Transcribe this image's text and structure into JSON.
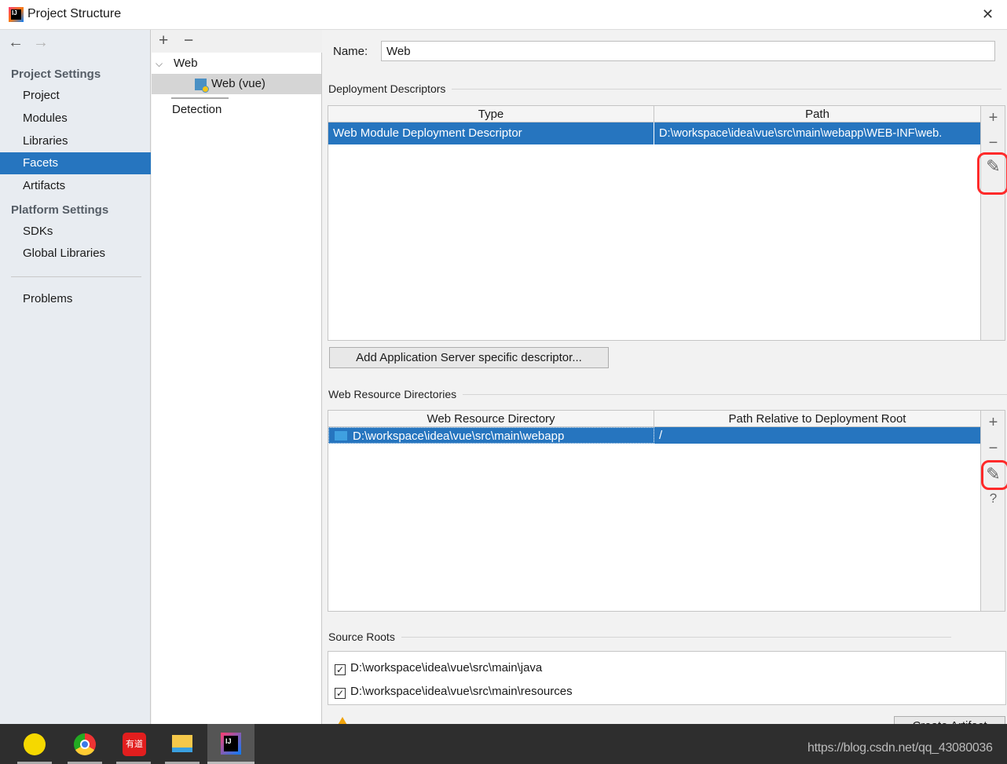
{
  "window": {
    "title": "Project Structure",
    "close": "✕"
  },
  "sidebar": {
    "back": "←",
    "forward": "→",
    "project_settings": "Project Settings",
    "items": [
      "Project",
      "Modules",
      "Libraries",
      "Facets",
      "Artifacts"
    ],
    "platform_settings": "Platform Settings",
    "platform_items": [
      "SDKs",
      "Global Libraries"
    ],
    "problems": "Problems",
    "selected": "Facets"
  },
  "tree": {
    "add": "+",
    "remove": "−",
    "root": "Web",
    "child": "Web (vue)",
    "detection": "Detection"
  },
  "name": {
    "label": "Name:",
    "value": "Web"
  },
  "deployment": {
    "title": "Deployment Descriptors",
    "columns": [
      "Type",
      "Path"
    ],
    "rows": [
      {
        "type": "Web Module Deployment Descriptor",
        "path": "D:\\workspace\\idea\\vue\\src\\main\\webapp\\WEB-INF\\web."
      }
    ],
    "add_button": "Add Application Server specific descriptor..."
  },
  "resources": {
    "title": "Web Resource Directories",
    "columns": [
      "Web Resource Directory",
      "Path Relative to Deployment Root"
    ],
    "rows": [
      {
        "dir": "D:\\workspace\\idea\\vue\\src\\main\\webapp",
        "path": "/"
      }
    ]
  },
  "toolbar": {
    "add": "+",
    "remove": "−",
    "edit": "✎",
    "help": "?"
  },
  "source_roots": {
    "title": "Source Roots",
    "items": [
      {
        "path": "D:\\workspace\\idea\\vue\\src\\main\\java",
        "checked": true
      },
      {
        "path": "D:\\workspace\\idea\\vue\\src\\main\\resources",
        "checked": true
      }
    ]
  },
  "bottom": {
    "create_artifact": "Create Artifact"
  },
  "taskbar": {
    "apps": [
      "qq-music",
      "chrome",
      "youdao",
      "file-explorer",
      "intellij-idea"
    ],
    "youdao_label": "有道"
  },
  "watermark": "https://blog.csdn.net/qq_43080036",
  "colors": {
    "selection": "#2675bf",
    "annotation": "#ff2a2a"
  }
}
